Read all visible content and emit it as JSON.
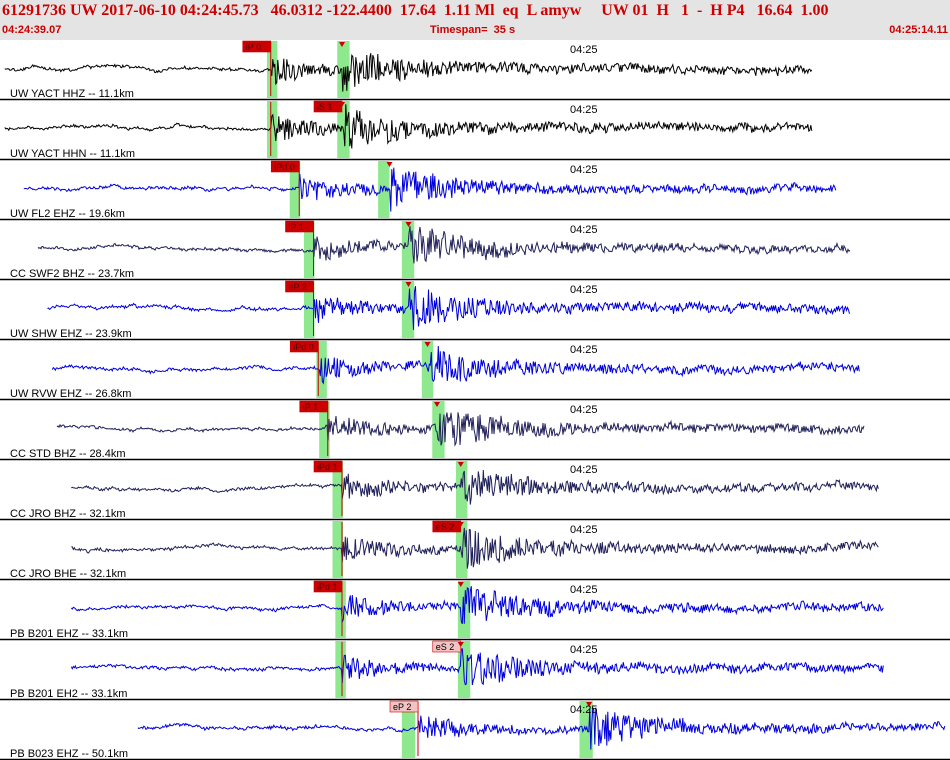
{
  "header": {
    "summary": "61291736 UW 2017-06-10 04:24:45.73   46.0312 -122.4400  17.64  1.11 Ml  eq  L amyw     UW 01  H   1  -  H P4   16.64  1.00",
    "start_time": "04:24:39.07",
    "timespan": "Timespan=  35 s",
    "end_time": "04:25:14.11"
  },
  "colors": {
    "header_bg": "#e4e4e4",
    "header_text": "#cc0000",
    "pick_red": "#cc0000",
    "pick_pink": "#f4c2c2",
    "marker_green": "#8ee88e",
    "trace_black": "#000000",
    "trace_blue": "#0000dd",
    "trace_navy": "#20205a",
    "panel_border": "#000000",
    "label_text": "#000000"
  },
  "time_marker": "04:25",
  "panels": [
    {
      "label": "UW YACT HHZ -- 11.1km",
      "trace_color": "black",
      "signal": [
        0.005,
        0.855
      ],
      "p_arrival": 0.285,
      "s_arrival": 0.36,
      "picks": [
        {
          "text": "iP 0",
          "style": "red"
        }
      ],
      "greens": [
        [
          0.281,
          0.292
        ],
        [
          0.355,
          0.368
        ]
      ]
    },
    {
      "label": "UW YACT HHN -- 11.1km",
      "trace_color": "black",
      "signal": [
        0.005,
        0.855
      ],
      "p_arrival": 0.285,
      "s_arrival": 0.36,
      "picks": [
        {
          "text": "iS 1",
          "style": "red"
        }
      ],
      "greens": [
        [
          0.281,
          0.292
        ],
        [
          0.355,
          0.368
        ]
      ]
    },
    {
      "label": "UW FL2 EHZ -- 19.6km",
      "trace_color": "blue",
      "signal": [
        0.025,
        0.88
      ],
      "p_arrival": 0.315,
      "s_arrival": 0.41,
      "picks": [
        {
          "text": "iPd 0",
          "style": "red"
        }
      ],
      "greens": [
        [
          0.305,
          0.316
        ],
        [
          0.398,
          0.41
        ]
      ]
    },
    {
      "label": "CC SWF2 BHZ -- 23.7km",
      "trace_color": "navy",
      "signal": [
        0.04,
        0.895
      ],
      "p_arrival": 0.33,
      "s_arrival": 0.43,
      "picks": [
        {
          "text": "iP 1",
          "style": "red"
        }
      ],
      "greens": [
        [
          0.32,
          0.331
        ],
        [
          0.423,
          0.436
        ]
      ]
    },
    {
      "label": "UW SHW EHZ -- 23.9km",
      "trace_color": "blue",
      "signal": [
        0.05,
        0.895
      ],
      "p_arrival": 0.33,
      "s_arrival": 0.43,
      "picks": [
        {
          "text": "eP 2",
          "style": "red"
        }
      ],
      "greens": [
        [
          0.32,
          0.331
        ],
        [
          0.423,
          0.436
        ]
      ]
    },
    {
      "label": "UW RVW EHZ -- 26.8km",
      "trace_color": "blue",
      "signal": [
        0.055,
        0.905
      ],
      "p_arrival": 0.335,
      "s_arrival": 0.45,
      "picks": [
        {
          "text": "iPd 0",
          "style": "red"
        }
      ],
      "greens": [
        [
          0.333,
          0.344
        ],
        [
          0.444,
          0.456
        ]
      ]
    },
    {
      "label": "CC STD BHZ -- 28.4km",
      "trace_color": "navy",
      "signal": [
        0.06,
        0.91
      ],
      "p_arrival": 0.345,
      "s_arrival": 0.46,
      "picks": [
        {
          "text": "iP 1",
          "style": "red"
        }
      ],
      "greens": [
        [
          0.336,
          0.347
        ],
        [
          0.455,
          0.468
        ]
      ]
    },
    {
      "label": "CC JRO BHZ -- 32.1km",
      "trace_color": "navy",
      "signal": [
        0.075,
        0.925
      ],
      "p_arrival": 0.36,
      "s_arrival": 0.485,
      "picks": [
        {
          "text": "iPd 1",
          "style": "red"
        }
      ],
      "greens": [
        [
          0.35,
          0.361
        ],
        [
          0.48,
          0.492
        ]
      ]
    },
    {
      "label": "CC JRO BHE -- 32.1km",
      "trace_color": "navy",
      "signal": [
        0.075,
        0.925
      ],
      "p_arrival": 0.36,
      "s_arrival": 0.485,
      "picks": [
        {
          "text": "eS 2",
          "style": "red"
        }
      ],
      "greens": [
        [
          0.35,
          0.361
        ],
        [
          0.48,
          0.492
        ]
      ]
    },
    {
      "label": "PB B201 EHZ -- 33.1km",
      "trace_color": "blue",
      "signal": [
        0.075,
        0.93
      ],
      "p_arrival": 0.36,
      "s_arrival": 0.485,
      "picks": [
        {
          "text": "iPd 1",
          "style": "red"
        }
      ],
      "greens": [
        [
          0.353,
          0.364
        ],
        [
          0.482,
          0.495
        ]
      ]
    },
    {
      "label": "PB B201 EH2 -- 33.1km",
      "trace_color": "blue",
      "signal": [
        0.075,
        0.93
      ],
      "p_arrival": 0.36,
      "s_arrival": 0.485,
      "picks": [
        {
          "text": "eS 2",
          "style": "pink"
        }
      ],
      "greens": [
        [
          0.353,
          0.364
        ],
        [
          0.482,
          0.495
        ]
      ]
    },
    {
      "label": "PB B023 EHZ -- 50.1km",
      "trace_color": "blue",
      "signal": [
        0.145,
        0.995
      ],
      "p_arrival": 0.44,
      "s_arrival": 0.62,
      "picks": [
        {
          "text": "eP 2",
          "style": "pink"
        }
      ],
      "greens": [
        [
          0.423,
          0.437
        ],
        [
          0.61,
          0.624
        ]
      ]
    }
  ]
}
